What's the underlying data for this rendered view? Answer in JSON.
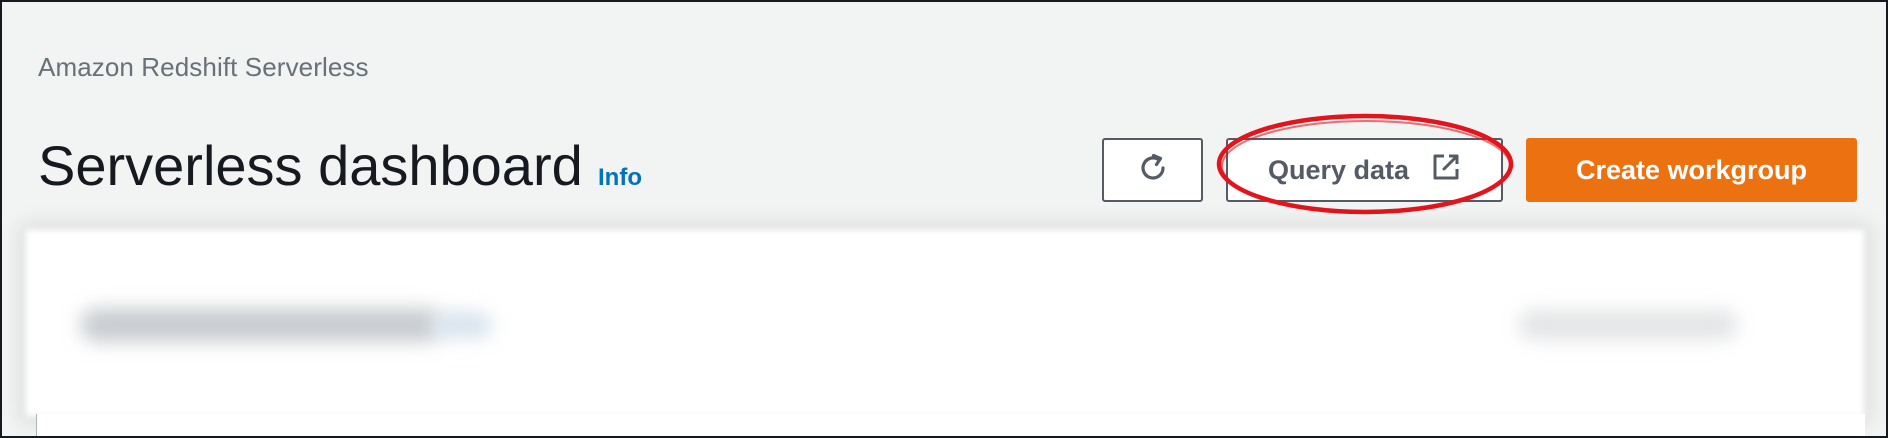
{
  "header": {
    "breadcrumb": "Amazon Redshift Serverless",
    "title": "Serverless dashboard",
    "info_label": "Info"
  },
  "actions": {
    "refresh_icon": "refresh-icon",
    "query_data_label": "Query data",
    "query_data_icon": "external-link-icon",
    "create_workgroup_label": "Create workgroup"
  },
  "colors": {
    "primary_button": "#ec7211",
    "link": "#0073bb",
    "highlight_annotation": "#e3141c",
    "background": "#f2f3f3"
  }
}
